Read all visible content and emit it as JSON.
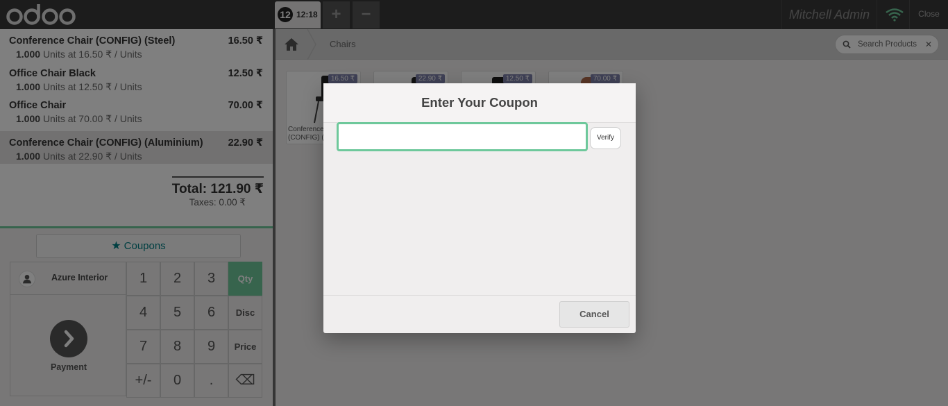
{
  "header": {
    "order_number": "12",
    "order_time": "12:18",
    "add_order_label": "+",
    "remove_order_label": "−",
    "user_name": "Mitchell Admin",
    "close_label": "Close",
    "brand_color": "#6ec89b"
  },
  "order": {
    "lines": [
      {
        "name": "Conference Chair (CONFIG) (Steel)",
        "price": "16.50 ₹",
        "qty": "1.000",
        "info": "Units at 16.50 ₹ / Units"
      },
      {
        "name": "Office Chair Black",
        "price": "12.50 ₹",
        "qty": "1.000",
        "info": "Units at 12.50 ₹ / Units"
      },
      {
        "name": "Office Chair",
        "price": "70.00 ₹",
        "qty": "1.000",
        "info": "Units at 70.00 ₹ / Units"
      },
      {
        "name": "Conference Chair (CONFIG) (Aluminium)",
        "price": "22.90 ₹",
        "qty": "1.000",
        "info": "Units at 22.90 ₹ / Units"
      }
    ],
    "total": "Total: 121.90 ₹",
    "taxes": "Taxes: 0.00 ₹"
  },
  "controls": {
    "coupons_label": "Coupons",
    "customer_name": "Azure Interior",
    "payment_label": "Payment",
    "numpad": {
      "k1": "1",
      "k2": "2",
      "k3": "3",
      "qty": "Qty",
      "k4": "4",
      "k5": "5",
      "k6": "6",
      "disc": "Disc",
      "k7": "7",
      "k8": "8",
      "k9": "9",
      "price": "Price",
      "sign": "+/-",
      "k0": "0",
      "dot": ".",
      "backspace": "⌫"
    }
  },
  "products": {
    "breadcrumb": "Chairs",
    "search_placeholder": "Search Products",
    "items": [
      {
        "price": "16.50 ₹",
        "name": "Conference Chair (CONFIG) (Steel)"
      },
      {
        "price": "22.90 ₹",
        "name": ""
      },
      {
        "price": "12.50 ₹",
        "name": ""
      },
      {
        "price": "70.00 ₹",
        "name": ""
      }
    ]
  },
  "popup": {
    "title": "Enter Your Coupon",
    "input_value": "",
    "verify_label": "Verify",
    "cancel_label": "Cancel"
  }
}
